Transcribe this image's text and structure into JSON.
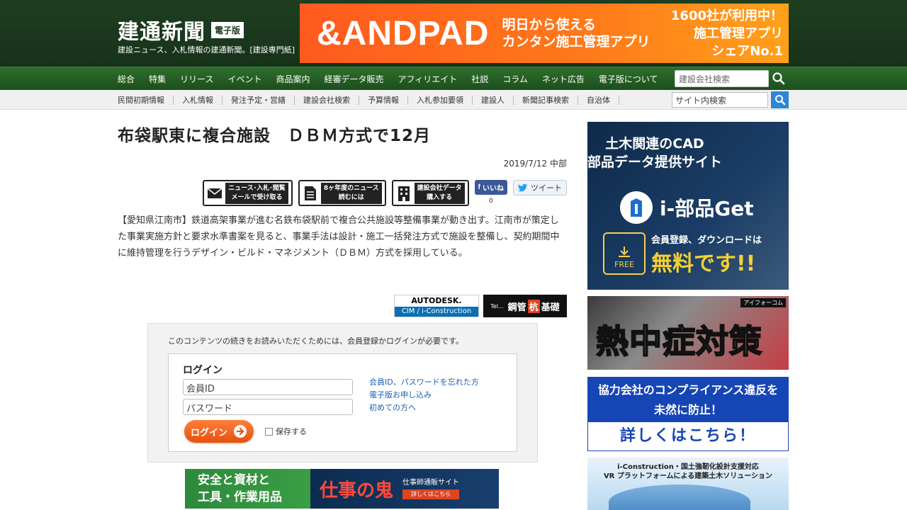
{
  "header": {
    "logo": "建通新聞",
    "logo_badge": "電子版",
    "tagline": "建設ニュース、入札情報の建通新聞。[建設専門紙]",
    "ad": {
      "brand": "&ANDPAD",
      "copy_line1": "明日から使える",
      "copy_line2": "カンタン施工管理アプリ",
      "right_line1": "1600社が利用中！",
      "right_line2": "施工管理アプリ",
      "right_line3": "シェアNo.1"
    }
  },
  "nav_main": {
    "items": [
      "総合",
      "特集",
      "リリース",
      "イベント",
      "商品案内",
      "経審データ販売",
      "アフィリエイト",
      "社説",
      "コラム",
      "ネット広告",
      "電子版について"
    ],
    "search_placeholder": "建設会社検索"
  },
  "nav_sub": {
    "items": [
      "民間初期情報",
      "入札情報",
      "発注予定・営繕",
      "建設会社検索",
      "予算情報",
      "入札参加要領",
      "建設人",
      "新聞記事検索",
      "自治体"
    ],
    "search_placeholder": "サイト内検索"
  },
  "article": {
    "title": "布袋駅東に複合施設　ＤＢＭ方式で12月",
    "date": "2019/7/12 中部",
    "actions": [
      {
        "line1": "ニュース･入札･閲覧",
        "line2": "メールで受け取る"
      },
      {
        "line1": "8ヶ年度のニュース",
        "line2": "読むには"
      },
      {
        "line1": "建設会社データ",
        "line2": "購入する"
      }
    ],
    "fb_label": "いいね",
    "fb_count": "0",
    "tweet_label": "ツイート",
    "body": "【愛知県江南市】鉄道高架事業が進む名鉄布袋駅前で複合公共施設等整備事業が動き出す。江南市が策定した事業実施方針と要求水準書案を見ると、事業手法は設計・施工一括発注方式で施設を整備し、契約期間中に維持管理を行うデザイン・ビルド・マネジメント（ＤＢＭ）方式を採用している。"
  },
  "sponsors": {
    "autodesk_top": "AUTODESK.",
    "autodesk_bottom": "CIM / i-Construction",
    "koukan_prefix": "Tel...",
    "koukan_a": "鋼管",
    "koukan_b": "杭",
    "koukan_c": "基礎"
  },
  "login": {
    "note": "このコンテンツの続きをお読みいただくためには、会員登録かログインが必要です。",
    "title": "ログイン",
    "id_placeholder": "会員ID",
    "password_placeholder": "パスワード",
    "forgot_link": "会員ID、パスワードを忘れた方",
    "apply_link": "電子版お申し込み",
    "first_link": "初めての方へ",
    "button": "ログイン",
    "remember": "保存する"
  },
  "ad_bottom": {
    "left_line1": "安全と資材と",
    "left_line2": "工具・作業用品",
    "middle": "仕事の鬼",
    "right_line1": "仕事師通販サイト",
    "right_line2": "詳しくはこちら"
  },
  "sidebar": {
    "ad1": {
      "line1": "土木関連のCAD",
      "line2": "部品データ提供サイト",
      "logo": "i-部品Get",
      "free": "FREE",
      "sub": "会員登録、ダウンロードは",
      "big": "無料です!!"
    },
    "ad2": {
      "brand": "アイフォーコム",
      "big": "熱中症対策"
    },
    "ad3": {
      "line1": "協力会社のコンプライアンス違反を",
      "line2": "未然に防止！",
      "cta": "詳しくはこちら！"
    },
    "ad4": {
      "line1": "i-Construction・国土強靭化設計支援対応",
      "line2": "VR プラットフォームによる建築土木ソリューション"
    }
  },
  "colors": {
    "header_green": "#1f3e21",
    "nav_green": "#2f6e2c",
    "search_blue": "#2e86d6",
    "login_orange": "#e8500d"
  }
}
